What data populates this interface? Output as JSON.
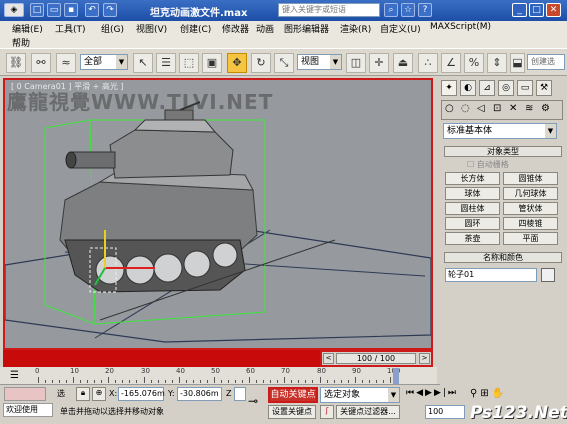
{
  "titlebar": {
    "title": "坦克动画激文件.max",
    "search_placeholder": "键入关键字或短语"
  },
  "menu": {
    "items": [
      "编辑(E)",
      "工具(T)",
      "组(G)",
      "视图(V)",
      "创建(C)",
      "修改器",
      "动画",
      "图形编辑器",
      "渲染(R)",
      "自定义(U)",
      "MAXScript(M)"
    ],
    "help": "帮助"
  },
  "toolbar": {
    "selection_filter": "全部",
    "ref_coord": "视图",
    "create_selection": "创建选"
  },
  "viewport": {
    "label": "[ 0 Camera01 ] 平滑 + 高光 ]",
    "watermark": "鷹龍視覺WWW.TLVI.NET"
  },
  "timeslider": {
    "value": "100 / 100"
  },
  "ruler": {
    "ticks": [
      "0",
      "10",
      "20",
      "30",
      "40",
      "50",
      "60",
      "70",
      "80",
      "90",
      "100"
    ]
  },
  "status": {
    "welcome": "欢迎使用",
    "prompt": "单击并拖动以选择并移动对象",
    "x_label": "X:",
    "x_value": "-165.076m",
    "y_label": "Y:",
    "y_value": "-30.806m",
    "auto_key": "自动关键点",
    "set_key": "设置关键点",
    "selected_object": "选定对象",
    "key_filters": "关键点过滤器...",
    "frame": "100",
    "select_label": "选",
    "grid_z": "Z"
  },
  "cmdpanel": {
    "dropdown": "标准基本体",
    "object_type_header": "对象类型",
    "autogrid": "自动栅格",
    "objects": [
      "长方体",
      "圆锥体",
      "球体",
      "几何球体",
      "圆柱体",
      "管状体",
      "圆环",
      "四棱锥",
      "茶壶",
      "平面"
    ],
    "name_color_header": "名称和颜色",
    "name_value": "轮子01"
  },
  "logo": "Ps123.Net"
}
